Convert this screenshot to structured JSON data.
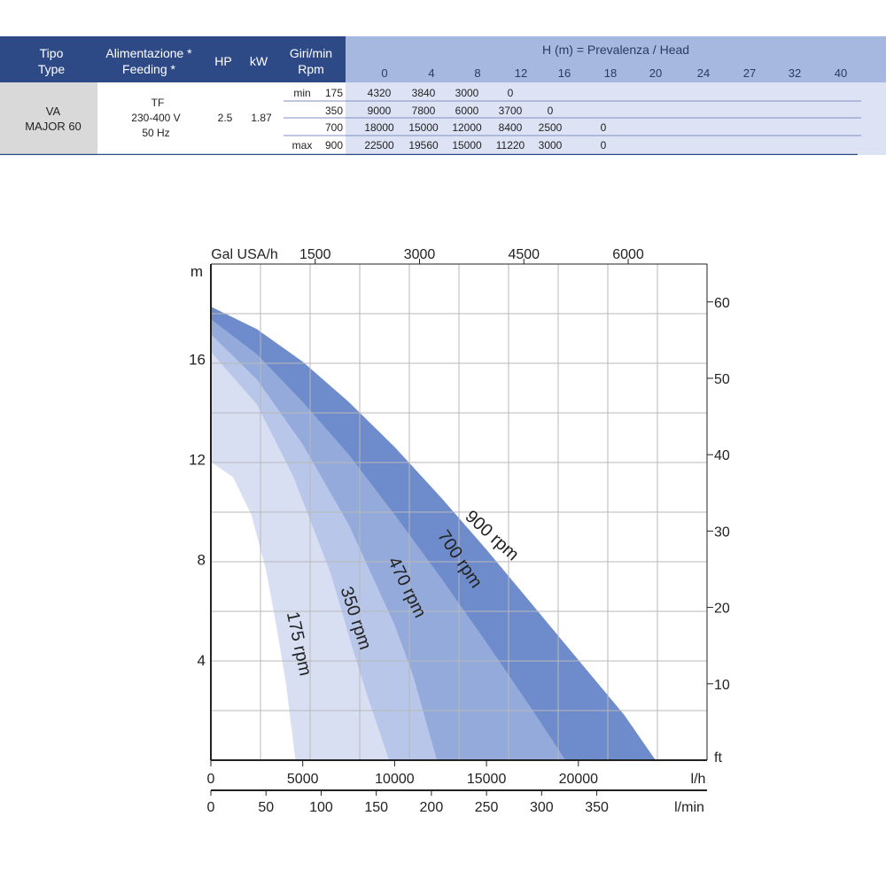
{
  "table": {
    "headers": {
      "tipo": "Tipo",
      "type": "Type",
      "alimentazione": "Alimentazione *",
      "feeding": "Feeding *",
      "hp": "HP",
      "kw": "kW",
      "giri": "Giri/min",
      "rpm": "Rpm",
      "head_title": "H (m) = Prevalenza /  Head"
    },
    "head_values": [
      "0",
      "4",
      "8",
      "12",
      "16",
      "18",
      "20",
      "24",
      "27",
      "32",
      "40"
    ],
    "model": [
      "VA",
      "MAJOR 60"
    ],
    "feeding": [
      "TF",
      "230-400 V",
      "50 Hz"
    ],
    "hp": "2.5",
    "kw": "1.87",
    "rows": [
      {
        "label": "min",
        "rpm": "175",
        "values": [
          "4320",
          "3840",
          "3000",
          "0"
        ]
      },
      {
        "label": "",
        "rpm": "350",
        "values": [
          "9000",
          "7800",
          "6000",
          "3700",
          "0"
        ]
      },
      {
        "label": "",
        "rpm": "700",
        "values": [
          "18000",
          "15000",
          "12000",
          "8400",
          "2500",
          "0"
        ]
      },
      {
        "label": "max",
        "rpm": "900",
        "values": [
          "22500",
          "19560",
          "15000",
          "11220",
          "3000",
          "0"
        ]
      }
    ],
    "colors": {
      "header_dark": "#2e4a86",
      "header_light": "#a7b8e0",
      "body_light": "#dde3f5",
      "model_cell": "#d9d9d9",
      "divider": "#7f8fc4"
    }
  },
  "chart_data": {
    "type": "area",
    "x_unit": "l/h",
    "y_unit": "m",
    "xlim": [
      0,
      27000
    ],
    "ylim": [
      0,
      19.8
    ],
    "x_ticks": [
      "0",
      "5000",
      "10000",
      "15000",
      "20000"
    ],
    "x_tick_values": [
      0,
      5000,
      10000,
      15000,
      20000
    ],
    "y_ticks": [
      "4",
      "8",
      "12",
      "16"
    ],
    "y_tick_values": [
      4,
      8,
      12,
      16
    ],
    "grid": true,
    "top_axis": {
      "label": "Gal USA/h",
      "ticks": [
        "1500",
        "3000",
        "4500",
        "6000"
      ],
      "tick_values": [
        1500,
        3000,
        4500,
        6000
      ]
    },
    "right_axis": {
      "label": "ft",
      "ticks": [
        "10",
        "20",
        "30",
        "40",
        "50",
        "60"
      ],
      "tick_values": [
        10,
        20,
        30,
        40,
        50,
        60
      ]
    },
    "bottom_axis2": {
      "label": "l/min",
      "ticks": [
        "0",
        "50",
        "100",
        "150",
        "200",
        "250",
        "300",
        "350"
      ],
      "tick_values": [
        0,
        50,
        100,
        150,
        200,
        250,
        300,
        350
      ]
    },
    "series": [
      {
        "name": "900 rpm",
        "color": "#6e8bcb",
        "x": [
          0,
          2500,
          5000,
          7500,
          10000,
          12500,
          15000,
          17500,
          20000,
          22500,
          24200
        ],
        "y": [
          18.1,
          17.2,
          15.9,
          14.3,
          12.5,
          10.5,
          8.4,
          6.2,
          4.0,
          1.8,
          0
        ]
      },
      {
        "name": "700 rpm",
        "color": "#94aadb",
        "x": [
          0,
          2500,
          5000,
          7500,
          10000,
          12500,
          15000,
          17500,
          19300
        ],
        "y": [
          17.6,
          16.2,
          14.3,
          12.2,
          9.8,
          7.3,
          4.7,
          2.0,
          0
        ]
      },
      {
        "name": "470 rpm",
        "color": "#b8c6ea",
        "x": [
          0,
          2500,
          5000,
          7500,
          10000,
          11000,
          12300
        ],
        "y": [
          17.0,
          15.2,
          12.6,
          9.4,
          5.4,
          3.4,
          0
        ]
      },
      {
        "name": "350 rpm",
        "color": "#d9dff3",
        "x": [
          0,
          2500,
          4500,
          6500,
          7700,
          8500,
          9700
        ],
        "y": [
          16.3,
          14.2,
          11.3,
          7.5,
          4.5,
          2.6,
          0
        ]
      },
      {
        "name": "175 rpm",
        "color": "#ffffff",
        "x": [
          0,
          1200,
          2200,
          3000,
          3600,
          4100,
          4600
        ],
        "y": [
          11.9,
          11.3,
          9.8,
          7.6,
          5.2,
          3.0,
          0
        ]
      }
    ],
    "labels": [
      {
        "text": "900 rpm",
        "x": 15100,
        "y": 8.8,
        "angle": 42
      },
      {
        "text": "700 rpm",
        "x": 13300,
        "y": 7.9,
        "angle": 56
      },
      {
        "text": "470 rpm",
        "x": 10400,
        "y": 6.8,
        "angle": 64
      },
      {
        "text": "350 rpm",
        "x": 7600,
        "y": 5.6,
        "angle": 72
      },
      {
        "text": "175 rpm",
        "x": 4500,
        "y": 4.6,
        "angle": 78
      }
    ]
  }
}
